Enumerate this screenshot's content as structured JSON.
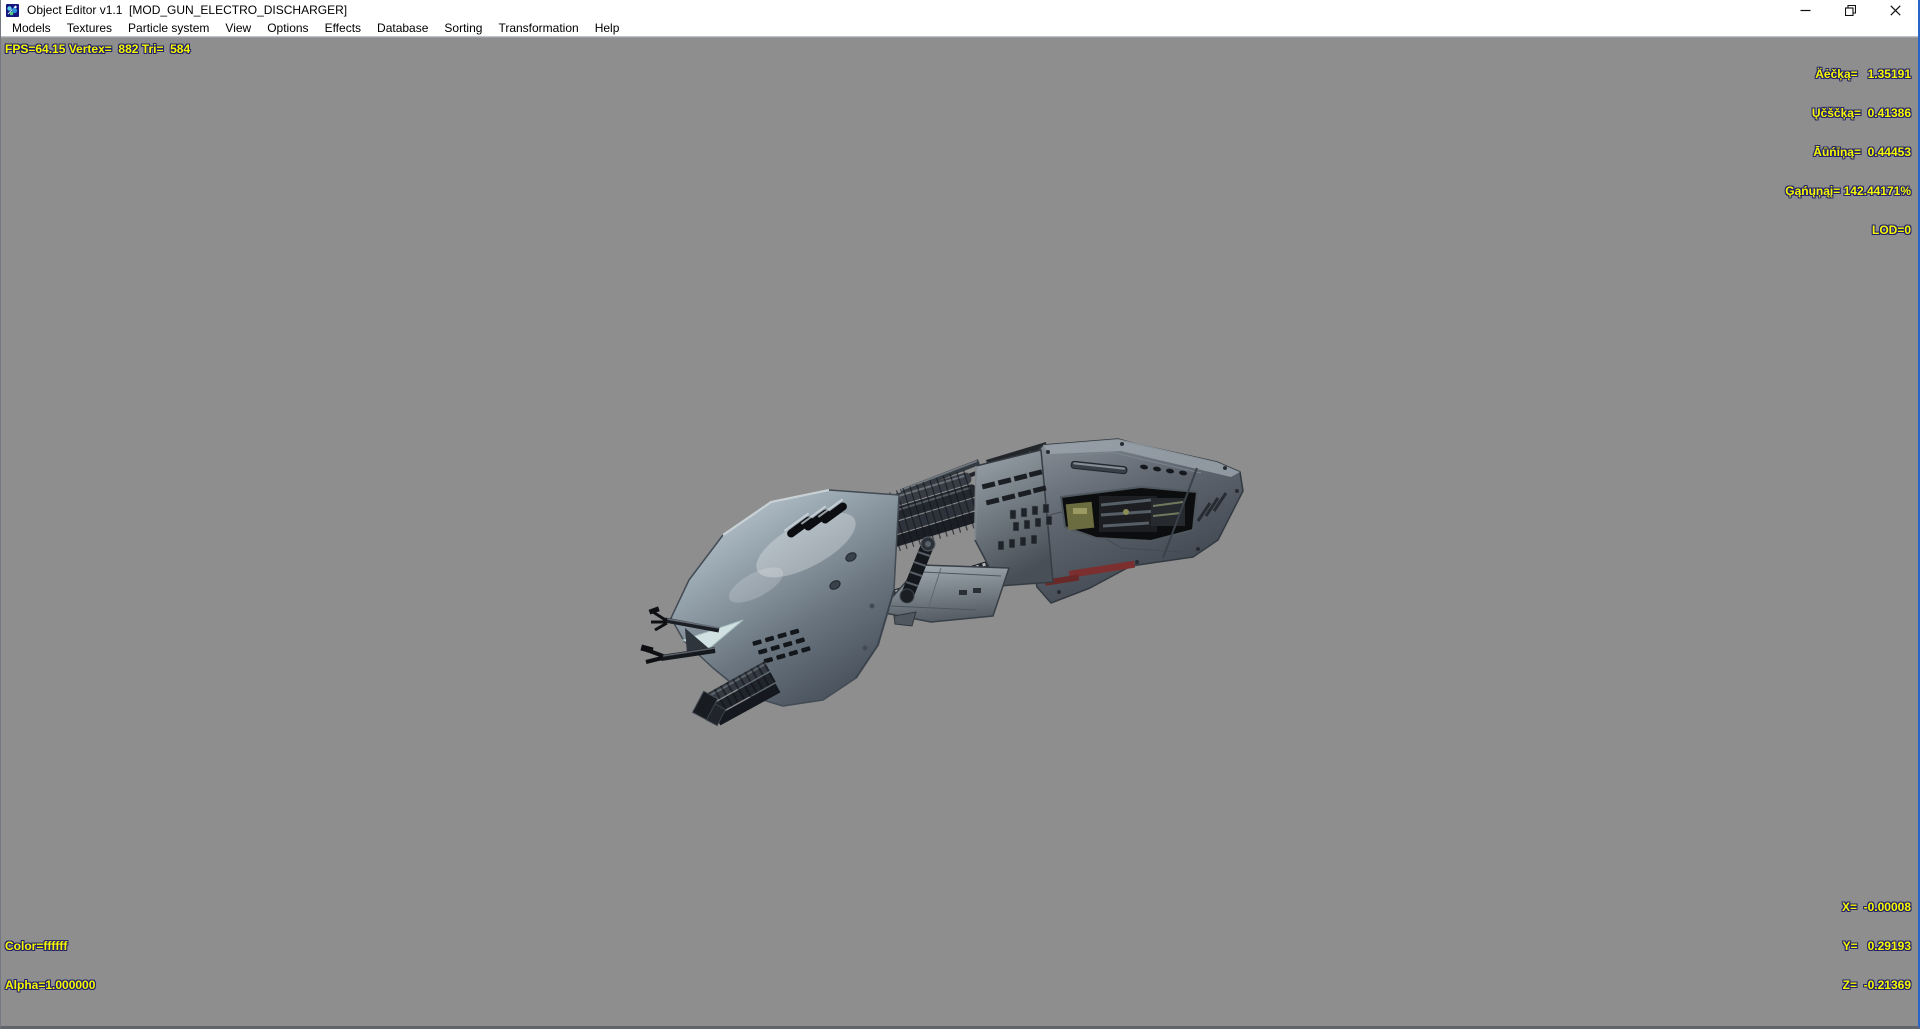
{
  "window": {
    "title": "Object Editor v1.1  [MOD_GUN_ELECTRO_DISCHARGER]",
    "controls": {
      "minimize": "minimize",
      "restore": "restore",
      "close": "close"
    }
  },
  "menu": {
    "items": [
      "Models",
      "Textures",
      "Particle system",
      "View",
      "Options",
      "Effects",
      "Database",
      "Sorting",
      "Transformation",
      "Help"
    ]
  },
  "viewport": {
    "background_color": "#8e8e8e",
    "overlay_text_color": "#f8f800",
    "overlay_outline_color": "#23236b",
    "stats_top_left": "FPS=64.15 Vertex=  882 Tri=  584",
    "stats_top_right": [
      "Äėčķą=   1.35191",
      "Ųčščķą=  0.41386",
      "Āūńīņą=  0.44453",
      "Ģąńųņąį= 142.44171%",
      "LOD=0"
    ],
    "stats_bottom_left": [
      "Color=ffffff",
      "Alpha=1.000000"
    ],
    "stats_bottom_right": [
      "X=  -0.00008",
      "Y=   0.29193",
      "Z=  -0.21369"
    ]
  },
  "border": {
    "accent_color": "#2a64c4"
  }
}
